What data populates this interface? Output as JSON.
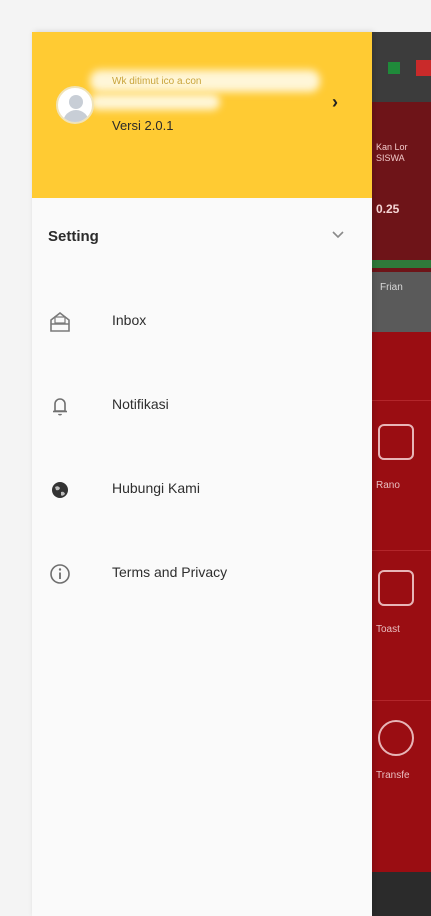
{
  "profile": {
    "user_name": "Wk ditimut ico a.con",
    "version": "Versi 2.0.1"
  },
  "settings": {
    "title": "Setting"
  },
  "menu": [
    {
      "label": "Inbox",
      "icon": "inbox-icon"
    },
    {
      "label": "Notifikasi",
      "icon": "bell-icon"
    },
    {
      "label": "Hubungi Kami",
      "icon": "globe-icon"
    },
    {
      "label": "Terms and Privacy",
      "icon": "info-icon"
    }
  ],
  "background_app": {
    "banner_text": "Kan Lor SISWA",
    "banner_number": "0.25",
    "strip_text": "Frian",
    "tile_labels": [
      "Rano",
      "Toast",
      "Transfe"
    ]
  },
  "colors": {
    "header_yellow": "#ffcb33",
    "drawer_bg": "#fafafa",
    "app_red": "#9a0d12"
  }
}
